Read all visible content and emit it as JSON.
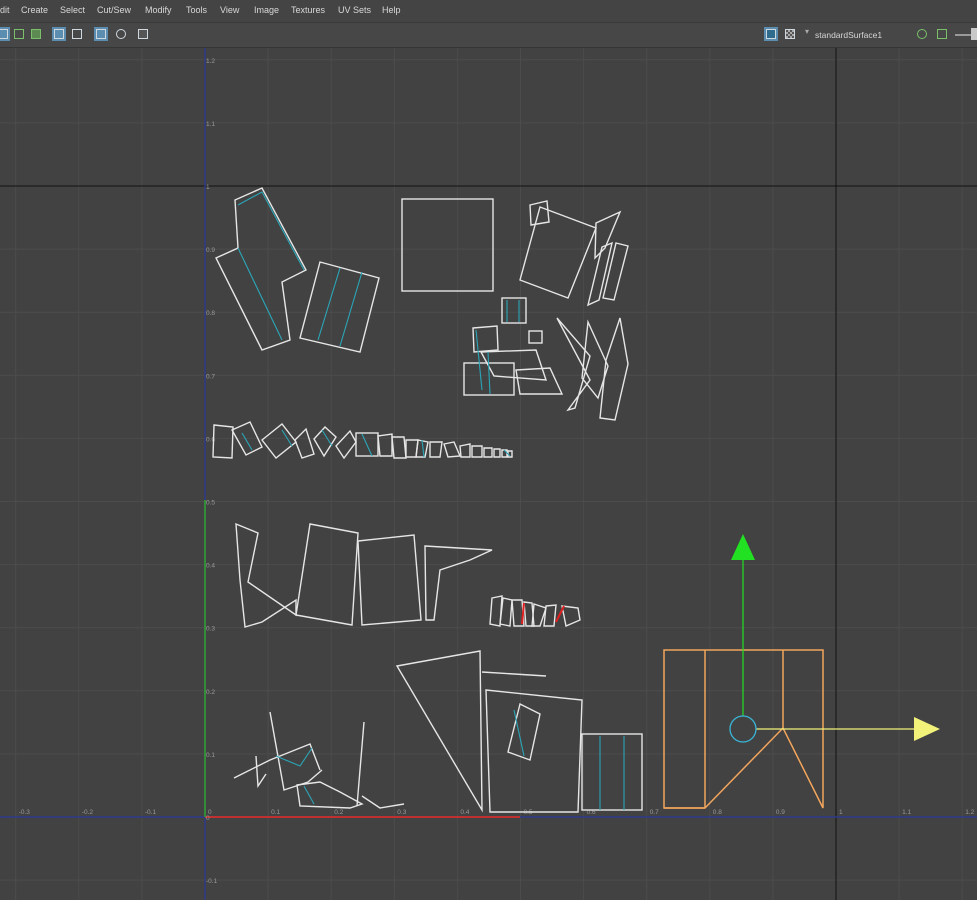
{
  "menubar": {
    "items": [
      "dit",
      "Create",
      "Select",
      "Cut/Sew",
      "Modify",
      "Tools",
      "View",
      "Image",
      "Textures",
      "UV Sets",
      "Help"
    ]
  },
  "toolbar": {
    "material_name": "standardSurface1"
  },
  "axes": {
    "u_ticks": [
      "-0.3",
      "-0.2",
      "-0.1",
      "0",
      "0.1",
      "0.2",
      "0.3",
      "0.4",
      "0.5",
      "0.6",
      "0.7",
      "0.8",
      "0.9",
      "1",
      "1.1",
      "1.2"
    ],
    "v_ticks": [
      "1.2",
      "1.1",
      "1",
      "0.9",
      "0.8",
      "0.7",
      "0.6",
      "0.5",
      "0.4",
      "0.3",
      "0.2",
      "0.1",
      "0",
      "-0.1"
    ]
  },
  "colors": {
    "background": "#424242",
    "grid": "#4c4c4c",
    "uv_border": "#111111",
    "shell": "#e6e6e6",
    "seam": "#2aa6b8",
    "selected": "#f2a55c",
    "manip_v": "#22e022",
    "manip_u": "#f2f27a",
    "manip_center": "#39b7d9",
    "axis_u": "#c03030",
    "axis_v": "#30a030",
    "origin_line": "#2d3b8c"
  }
}
